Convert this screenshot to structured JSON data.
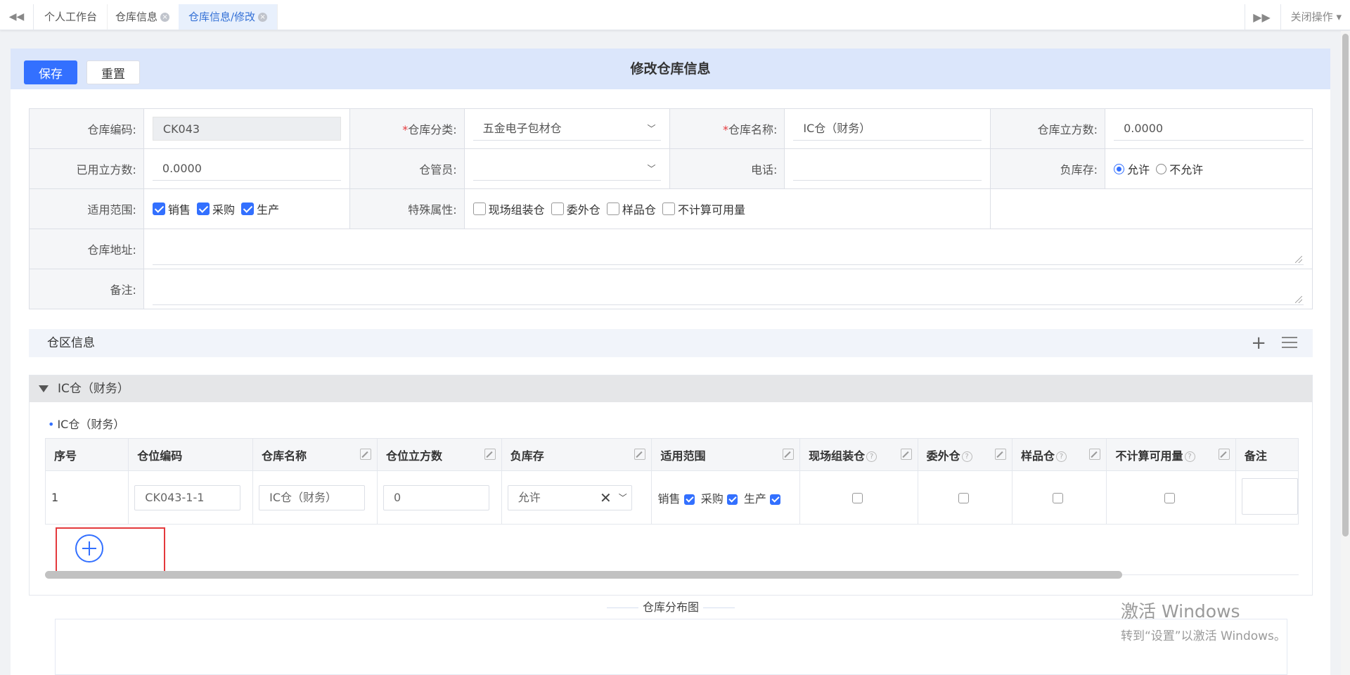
{
  "tabs": {
    "items": [
      {
        "label": "个人工作台"
      },
      {
        "label": "仓库信息"
      },
      {
        "label": "仓库信息/修改"
      }
    ],
    "close_ops": "关闭操作"
  },
  "toolbar": {
    "save_label": "保存",
    "reset_label": "重置",
    "title": "修改仓库信息"
  },
  "form": {
    "code_label": "仓库编码:",
    "code_value": "CK043",
    "category_label": "仓库分类:",
    "category_value": "五金电子包材仓",
    "name_label": "仓库名称:",
    "name_value": "IC仓（财务）",
    "volume_label": "仓库立方数:",
    "volume_value": "0.0000",
    "used_label": "已用立方数:",
    "used_value": "0.0000",
    "keeper_label": "仓管员:",
    "keeper_value": "",
    "phone_label": "电话:",
    "phone_value": "",
    "neg_label": "负库存:",
    "neg_allow": "允许",
    "neg_disallow": "不允许",
    "scope_label": "适用范围:",
    "scope_options": [
      "销售",
      "采购",
      "生产"
    ],
    "special_label": "特殊属性:",
    "special_options": [
      "现场组装仓",
      "委外仓",
      "样品仓",
      "不计算可用量"
    ],
    "address_label": "仓库地址:",
    "remark_label": "备注:"
  },
  "zone_section": {
    "title": "仓区信息",
    "group_title": "IC仓（财务）",
    "sub_title": "IC仓（财务）"
  },
  "grid": {
    "headers": [
      "序号",
      "仓位编码",
      "仓库名称",
      "仓位立方数",
      "负库存",
      "适用范围",
      "现场组装仓",
      "委外仓",
      "样品仓",
      "不计算可用量",
      "备注"
    ],
    "rows": [
      {
        "index": "1",
        "code": "CK043-1-1",
        "name": "IC仓（财务）",
        "volume": "0",
        "neg": "允许",
        "scope": [
          "销售",
          "采购",
          "生产"
        ]
      }
    ]
  },
  "distribution": {
    "title": "仓库分布图"
  },
  "watermark": {
    "line1": "激活 Windows",
    "line2": "转到“设置”以激活 Windows。"
  }
}
